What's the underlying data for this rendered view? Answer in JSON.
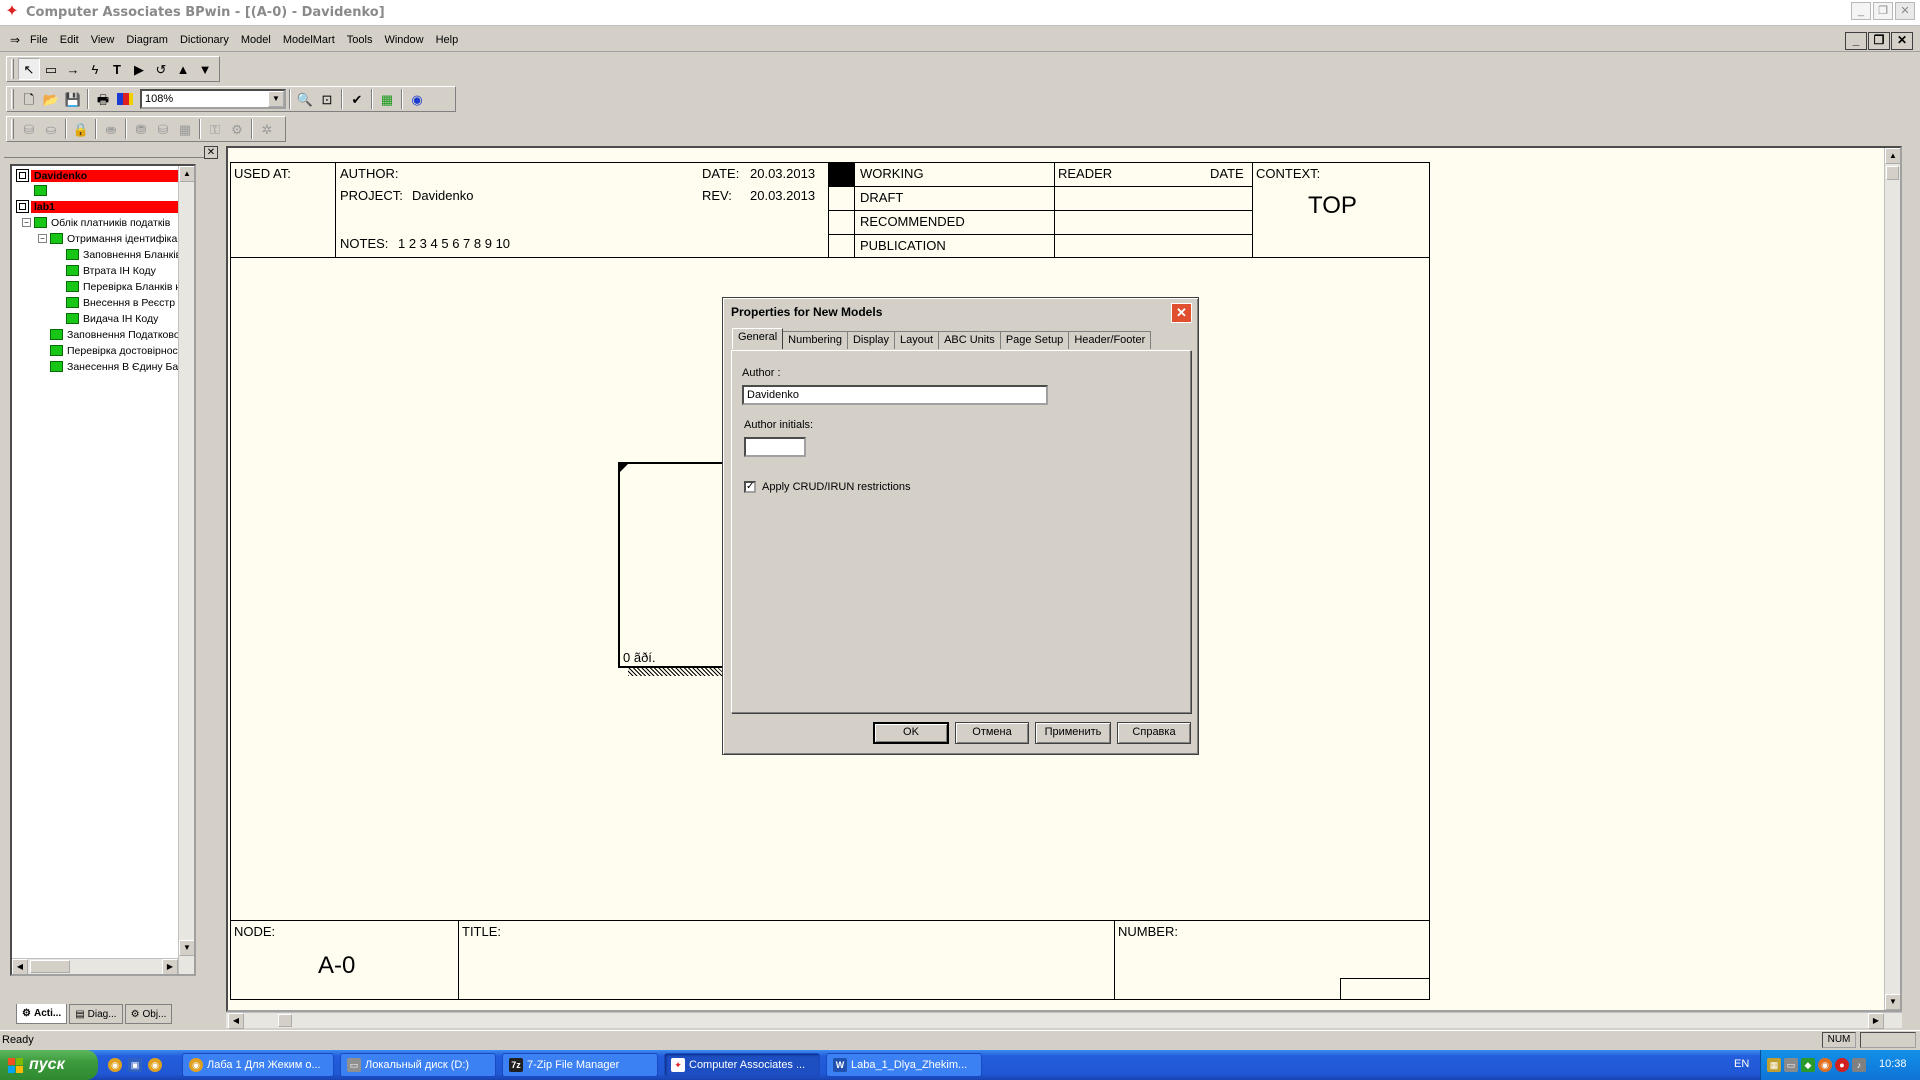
{
  "window": {
    "title": "Computer Associates BPwin - [(A-0)  - Davidenko]",
    "minimize": "_",
    "restore": "❐",
    "close": "✕"
  },
  "menubar": {
    "items": [
      "File",
      "Edit",
      "View",
      "Diagram",
      "Dictionary",
      "Model",
      "ModelMart",
      "Tools",
      "Window",
      "Help"
    ]
  },
  "toolbar": {
    "zoom_value": "108%"
  },
  "tree": {
    "items": [
      {
        "label": "Davidenko",
        "level": 0,
        "kind": "root"
      },
      {
        "label": "",
        "level": 1,
        "kind": "node"
      },
      {
        "label": "lab1",
        "level": 0,
        "kind": "root"
      },
      {
        "label": "Облік платників податків",
        "level": 1,
        "kind": "node"
      },
      {
        "label": "Отримання  ідентифіка",
        "level": 2,
        "kind": "node"
      },
      {
        "label": "Заповнення Бланків",
        "level": 3,
        "kind": "node"
      },
      {
        "label": "Втрата ІН Коду",
        "level": 3,
        "kind": "node"
      },
      {
        "label": "Перевірка Бланків  н",
        "level": 3,
        "kind": "node"
      },
      {
        "label": "Внесення в Реєстр",
        "level": 3,
        "kind": "node"
      },
      {
        "label": "Видача ІН Коду",
        "level": 3,
        "kind": "node"
      },
      {
        "label": "Заповнення Податково",
        "level": 2,
        "kind": "node"
      },
      {
        "label": "Перевірка достовірност",
        "level": 2,
        "kind": "node"
      },
      {
        "label": "Занесення В Єдину  Ба:",
        "level": 2,
        "kind": "node"
      }
    ],
    "tabs": [
      "Acti...",
      "Diag...",
      "Obj..."
    ]
  },
  "diagram": {
    "header": {
      "used_at_label": "USED AT:",
      "author_label": "AUTHOR:",
      "project_label": "PROJECT:",
      "project_value": "Davidenko",
      "date_label": "DATE:",
      "date_value": "20.03.2013",
      "rev_label": "REV:",
      "rev_value": "20.03.2013",
      "notes_label": "NOTES:",
      "notes_value": "1  2  3  4  5  6  7  8  9  10",
      "status_rows": [
        "WORKING",
        "DRAFT",
        "RECOMMENDED",
        "PUBLICATION"
      ],
      "reader_label": "READER",
      "reader_date_label": "DATE",
      "context_label": "CONTEXT:",
      "context_value": "TOP"
    },
    "footer": {
      "node_label": "NODE:",
      "node_value": "A-0",
      "title_label": "TITLE:",
      "number_label": "NUMBER:"
    },
    "box_label": "0 ãðí."
  },
  "dialog": {
    "title": "Properties for New Models",
    "tabs": [
      "General",
      "Numbering",
      "Display",
      "Layout",
      "ABC Units",
      "Page Setup",
      "Header/Footer"
    ],
    "author_label": "Author :",
    "author_value": "Davidenko",
    "initials_label": "Author initials:",
    "initials_value": "",
    "crud_label": "Apply CRUD/IRUN restrictions",
    "crud_checked": "✓",
    "buttons": {
      "ok": "OK",
      "cancel": "Отмена",
      "apply": "Применить",
      "help": "Справка"
    }
  },
  "statusbar": {
    "text": "Ready",
    "num": "NUM"
  },
  "taskbar": {
    "start": "пуск",
    "tasks": [
      "Лаба 1 Для Жеким о...",
      "Локальный диск (D:)",
      "7-Zip File Manager",
      "Computer Associates ...",
      "Laba_1_Dlya_Zhekim..."
    ],
    "lang": "EN",
    "clock": "10:38"
  }
}
